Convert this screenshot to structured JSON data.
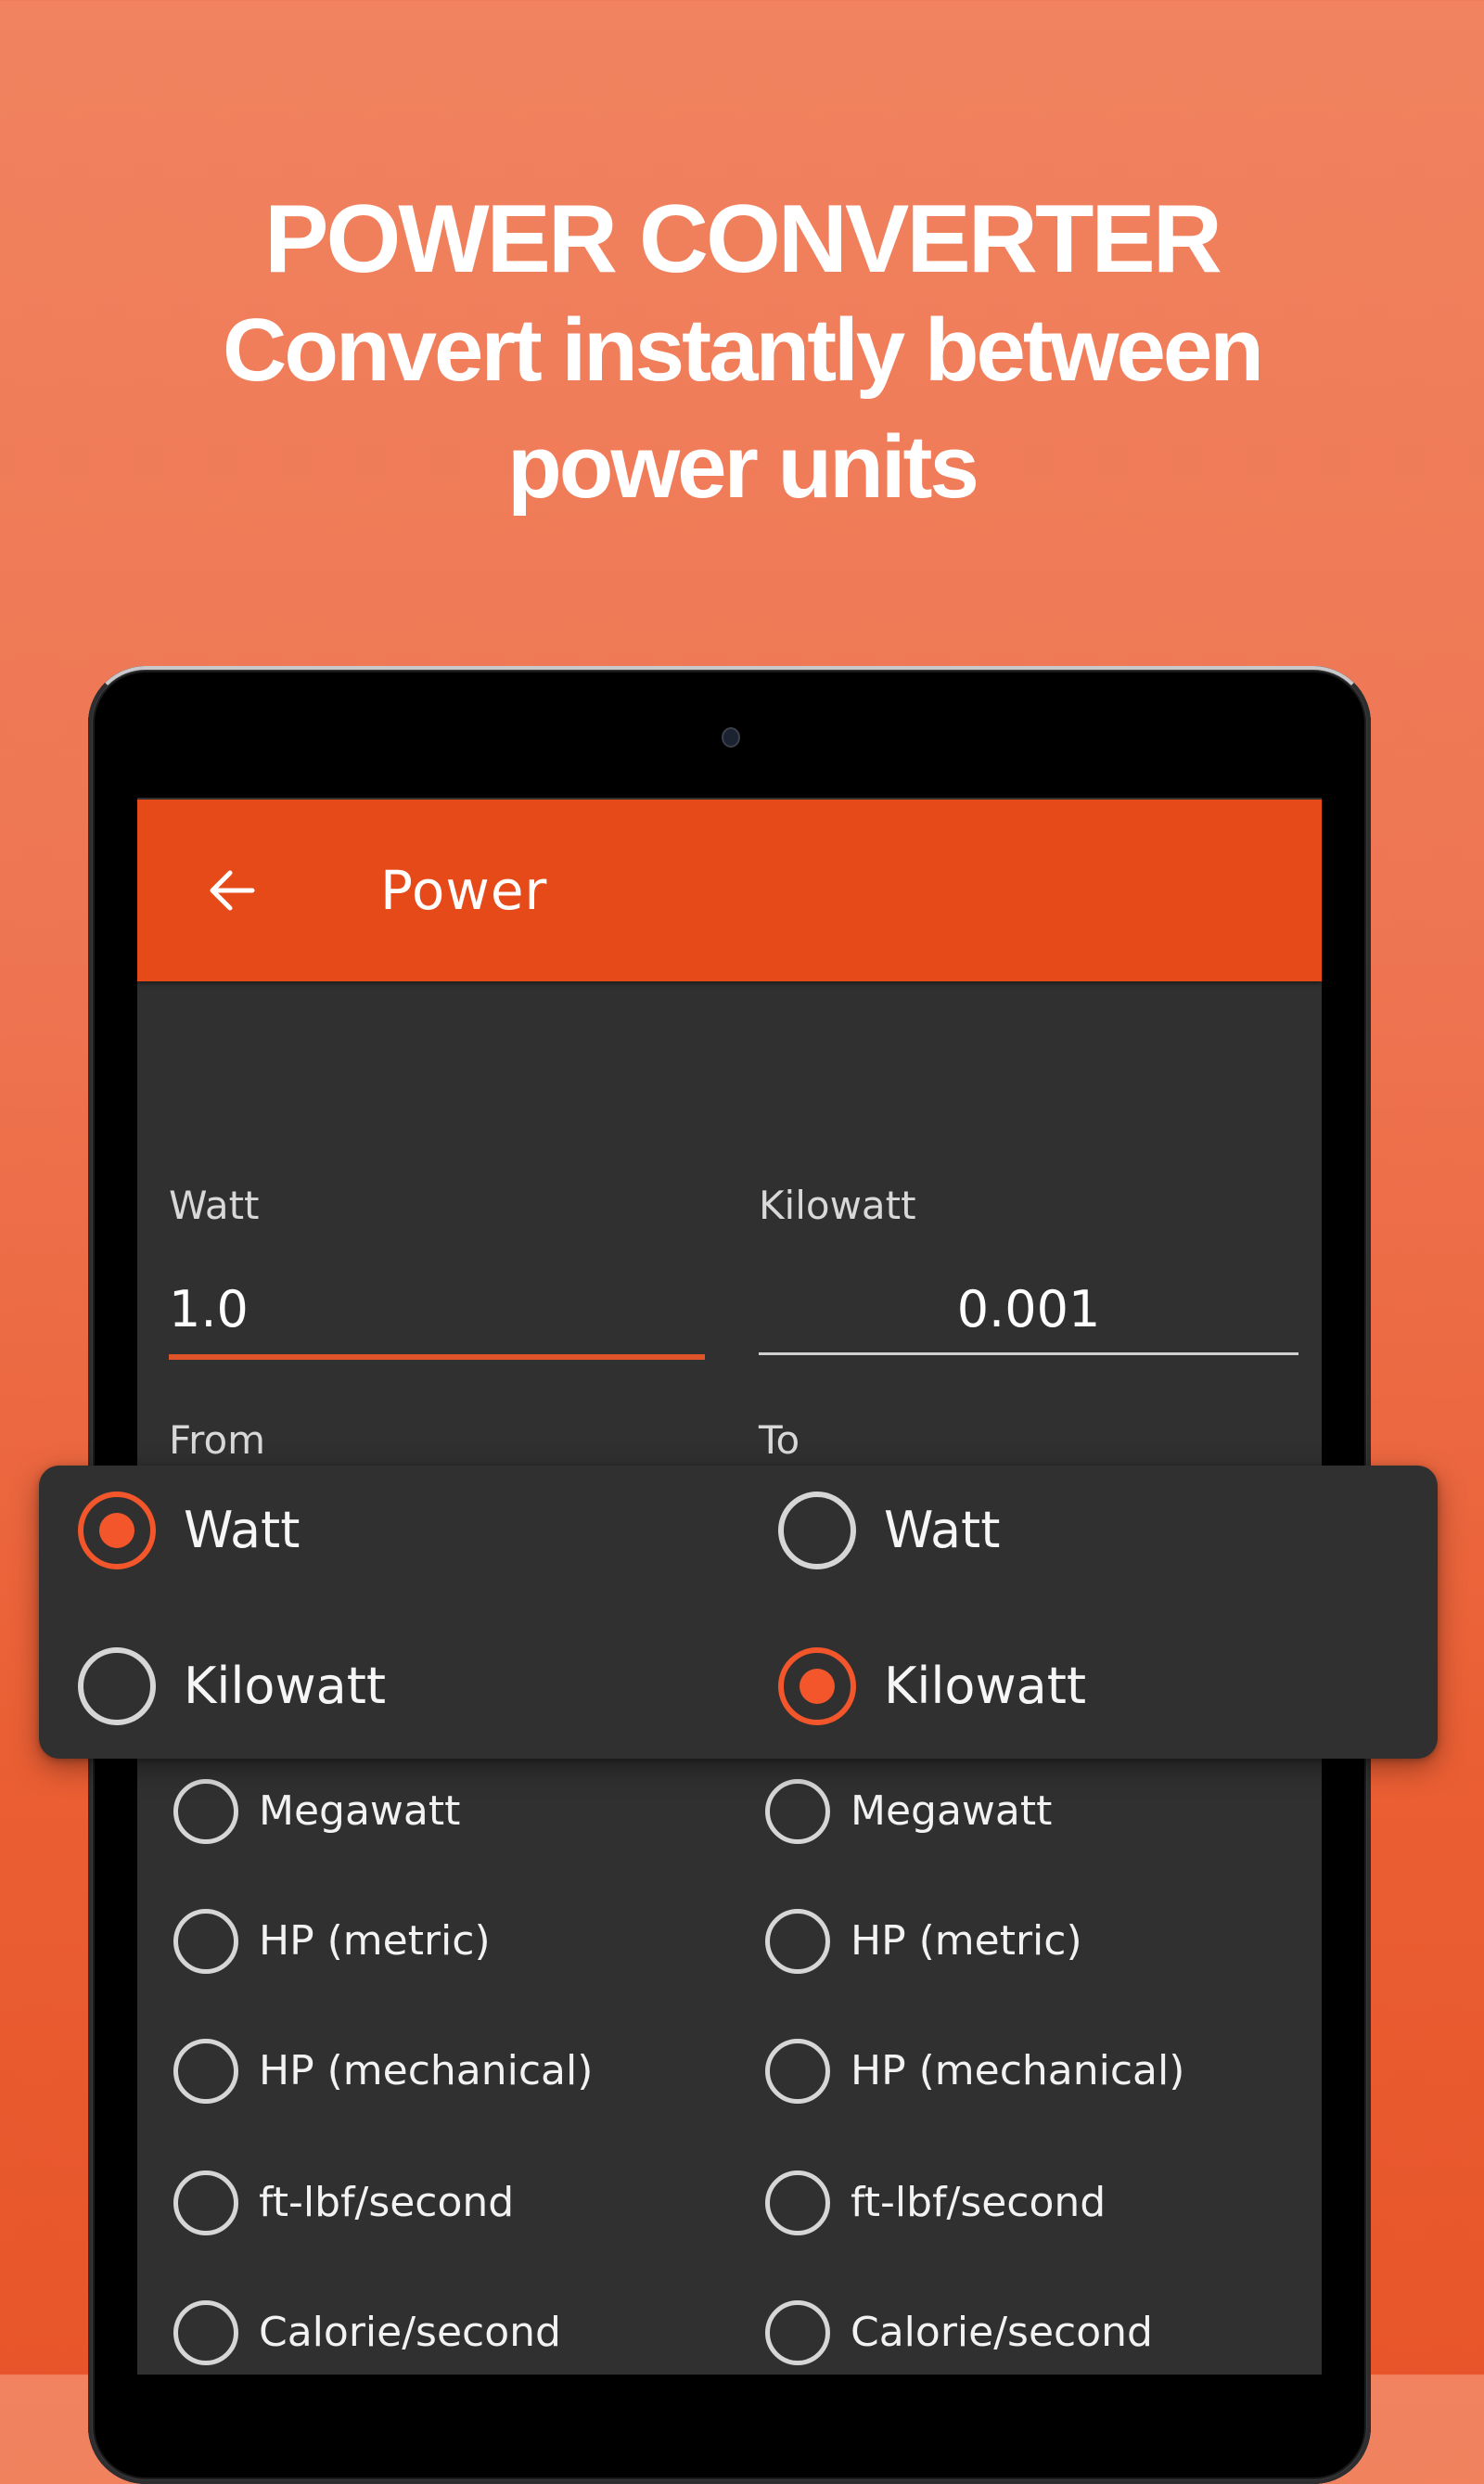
{
  "promo": {
    "title": "POWER CONVERTER",
    "subtitle_line1": "Convert instantly between",
    "subtitle_line2": "power units"
  },
  "colors": {
    "accent": "#E64A19",
    "radio_selected": "#F2562A",
    "background_dark": "#303030"
  },
  "appbar": {
    "back_icon": "arrow-left-icon",
    "title": "Power"
  },
  "converter": {
    "input": {
      "label": "Watt",
      "value": "1.0"
    },
    "output": {
      "label": "Kilowatt",
      "value": "0.001"
    },
    "from_label": "From",
    "to_label": "To"
  },
  "units": [
    "Watt",
    "Kilowatt",
    "Megawatt",
    "HP (metric)",
    "HP (mechanical)",
    "ft-lbf/second",
    "Calorie/second"
  ],
  "selected_from": "Watt",
  "selected_to": "Kilowatt"
}
